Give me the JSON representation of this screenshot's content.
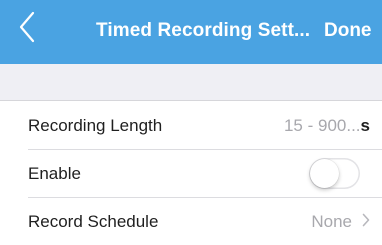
{
  "navbar": {
    "back_icon": "chevron-left-icon",
    "title": "Timed Recording Sett...",
    "done_label": "Done",
    "background_color": "#4aa3e2"
  },
  "settings": {
    "recording_length": {
      "label": "Recording Length",
      "placeholder": "15 - 900...",
      "unit": "s"
    },
    "enable": {
      "label": "Enable",
      "state": "off"
    },
    "record_schedule": {
      "label": "Record Schedule",
      "value": "None",
      "icon": "chevron-right-icon"
    }
  }
}
